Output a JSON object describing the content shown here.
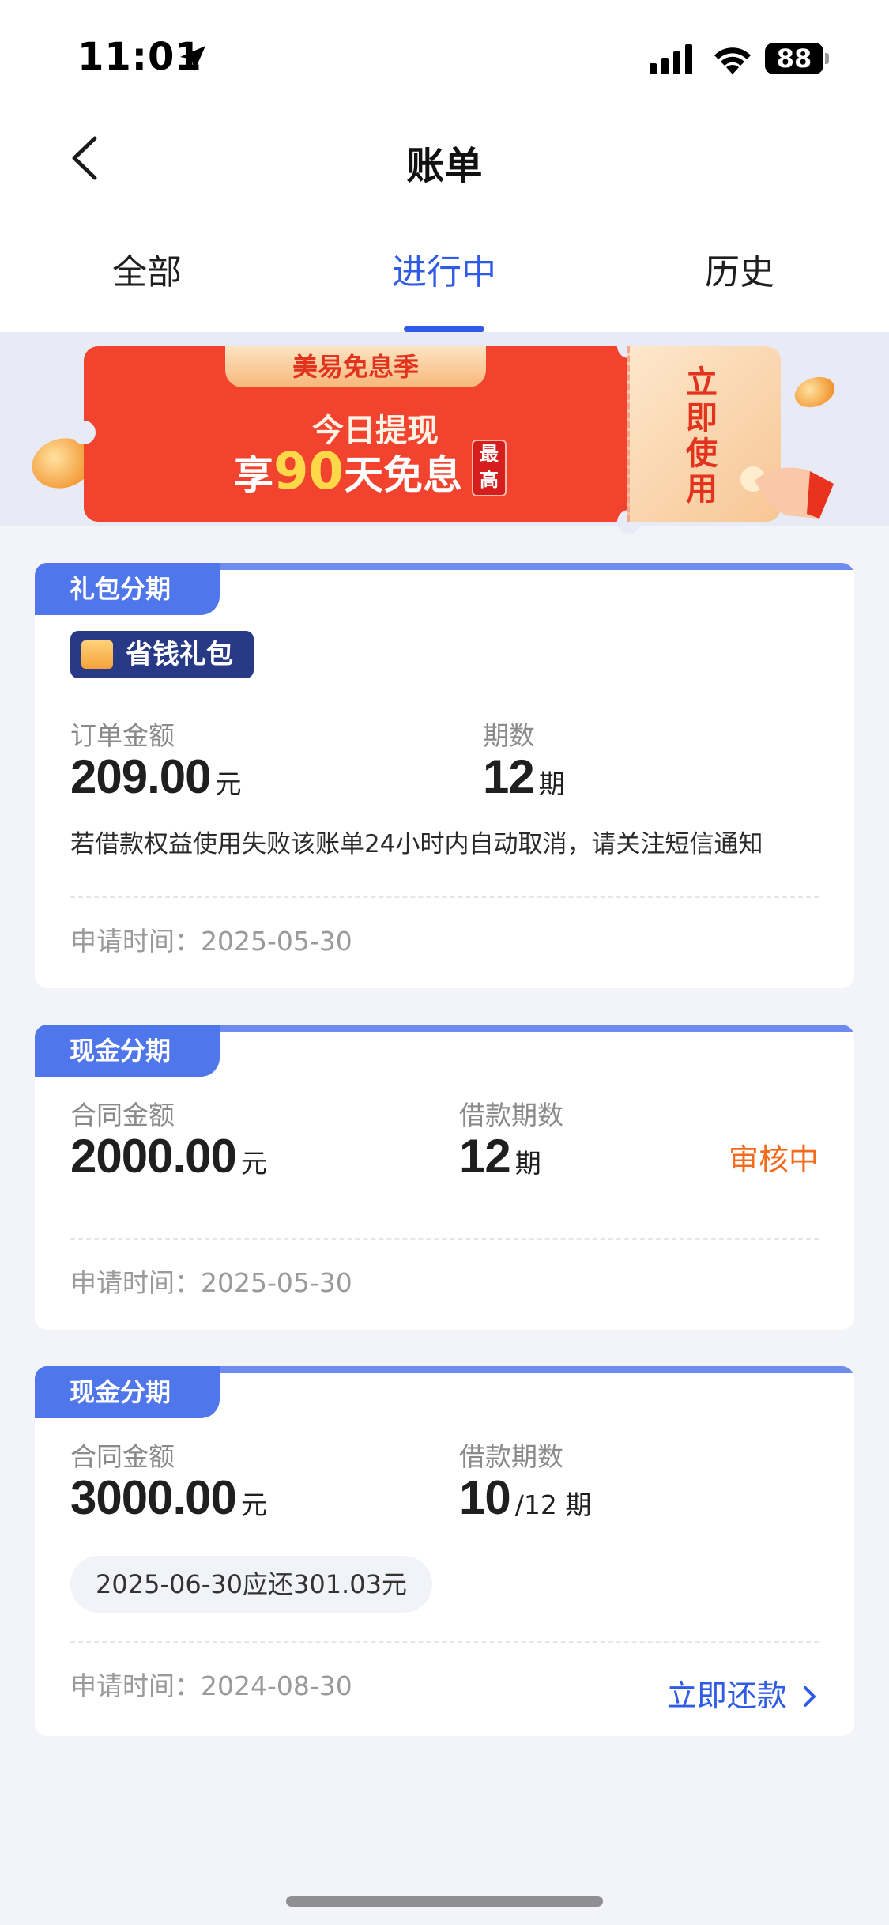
{
  "status_bar": {
    "time": "11:01",
    "battery": "88"
  },
  "header": {
    "title": "账单"
  },
  "tabs": [
    {
      "label": "全部"
    },
    {
      "label": "进行中",
      "active": true
    },
    {
      "label": "历史"
    }
  ],
  "banner": {
    "ribbon": "美易免息季",
    "line1": "今日提现",
    "line2_prefix": "享",
    "line2_number": "90",
    "line2_suffix": "天免息",
    "badge": "最高",
    "cta": "立即使用"
  },
  "cards": [
    {
      "tag": "礼包分期",
      "gift_badge": "省钱礼包",
      "amount_label": "订单金额",
      "amount": "209.00",
      "amount_unit": "元",
      "period_label": "期数",
      "period": "12",
      "period_unit": "期",
      "notice": "若借款权益使用失败该账单24小时内自动取消，请关注短信通知",
      "apply_time": "申请时间：2025-05-30"
    },
    {
      "tag": "现金分期",
      "amount_label": "合同金额",
      "amount": "2000.00",
      "amount_unit": "元",
      "period_label": "借款期数",
      "period": "12",
      "period_unit": "期",
      "status": "审核中",
      "apply_time": "申请时间：2025-05-30"
    },
    {
      "tag": "现金分期",
      "amount_label": "合同金额",
      "amount": "3000.00",
      "amount_unit": "元",
      "period_label": "借款期数",
      "period": "10",
      "period_unit": "/12 期",
      "due_note": "2025-06-30应还301.03元",
      "apply_time": "申请时间：2024-08-30",
      "action": "立即还款"
    }
  ],
  "colors": {
    "accent": "#2F5BE7",
    "tag_blue": "#4F76EA",
    "review_orange": "#F36B1C",
    "banner_red": "#F2432E"
  }
}
